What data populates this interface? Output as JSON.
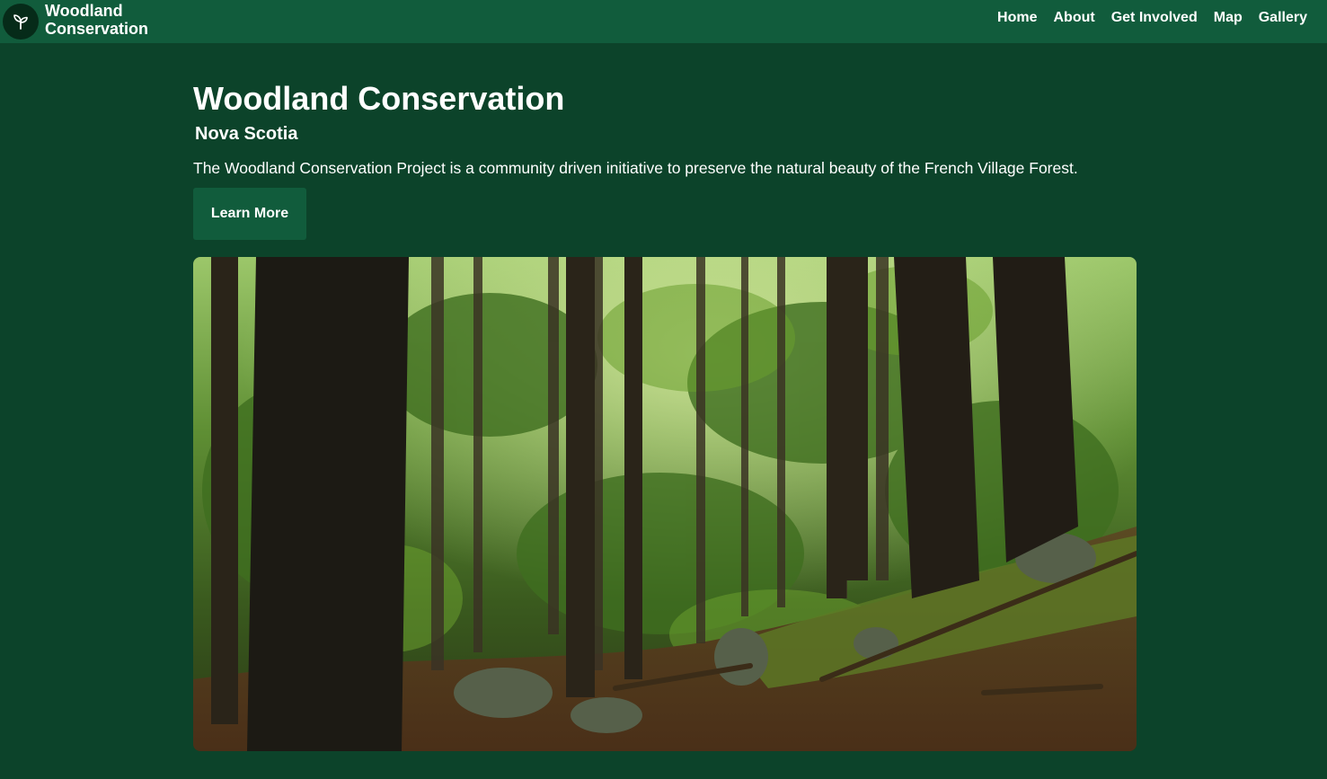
{
  "brand": {
    "name_line1": "Woodland",
    "name_line2": "Conservation",
    "logo_icon": "seedling-icon"
  },
  "nav": {
    "items": [
      {
        "label": "Home"
      },
      {
        "label": "About"
      },
      {
        "label": "Get Involved"
      },
      {
        "label": "Map"
      },
      {
        "label": "Gallery"
      }
    ]
  },
  "hero": {
    "title": "Woodland Conservation",
    "subtitle": "Nova Scotia",
    "description": "The Woodland Conservation Project is a community driven initiative to preserve the natural beauty of the French Village Forest.",
    "cta_label": "Learn More"
  },
  "colors": {
    "page_background": "#0c432a",
    "header_background": "#115c3c",
    "button_background": "#115c3c",
    "logo_background": "#062b19",
    "text": "#ffffff"
  }
}
